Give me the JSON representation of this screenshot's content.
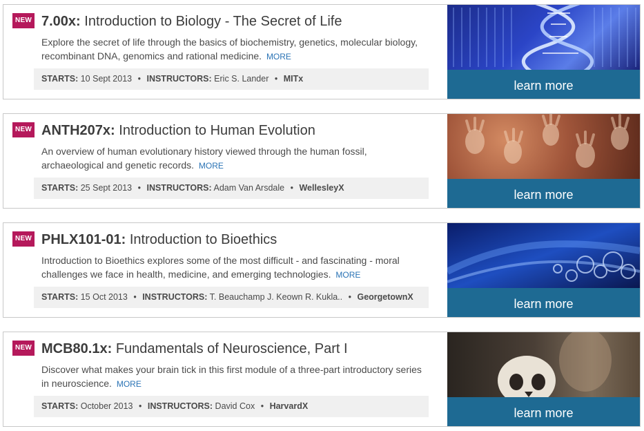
{
  "common": {
    "new_badge": "NEW",
    "more_label": "MORE",
    "learn_more_label": "learn more",
    "starts_label": "STARTS:",
    "instructors_label": "INSTRUCTORS:",
    "separator": "•"
  },
  "courses": [
    {
      "code": "7.00x:",
      "title": "Introduction to Biology - The Secret of Life",
      "description": "Explore the secret of life through the basics of biochemistry, genetics, molecular biology, recombinant DNA, genomics and rational medicine.",
      "starts": "10 Sept 2013",
      "instructors": "Eric S. Lander",
      "school": "MITx",
      "image": "dna-helix-image"
    },
    {
      "code": "ANTH207x:",
      "title": "Introduction to Human Evolution",
      "description": "An overview of human evolutionary history viewed through the human fossil, archaeological and genetic records.",
      "starts": "25 Sept 2013",
      "instructors": "Adam Van Arsdale",
      "school": "WellesleyX",
      "image": "cave-hands-image"
    },
    {
      "code": "PHLX101-01:",
      "title": "Introduction to Bioethics",
      "description": "Introduction to Bioethics explores some of the most difficult - and fascinating - moral challenges we face in health, medicine, and emerging technologies.",
      "starts": "15 Oct 2013",
      "instructors": "T. Beauchamp J. Keown R. Kukla..",
      "school": "GeorgetownX",
      "image": "molecular-structure-image"
    },
    {
      "code": "MCB80.1x:",
      "title": "Fundamentals of Neuroscience, Part I",
      "description": "Discover what makes your brain tick in this first module of a three-part introductory series in neuroscience.",
      "starts": "October 2013",
      "instructors": "David Cox",
      "school": "HarvardX",
      "image": "skull-instructor-image"
    }
  ],
  "colors": {
    "new_badge": "#b5195b",
    "learn_more_bg": "#1e6a93",
    "more_link": "#2a73b5",
    "meta_bg": "#f0f0f0"
  }
}
